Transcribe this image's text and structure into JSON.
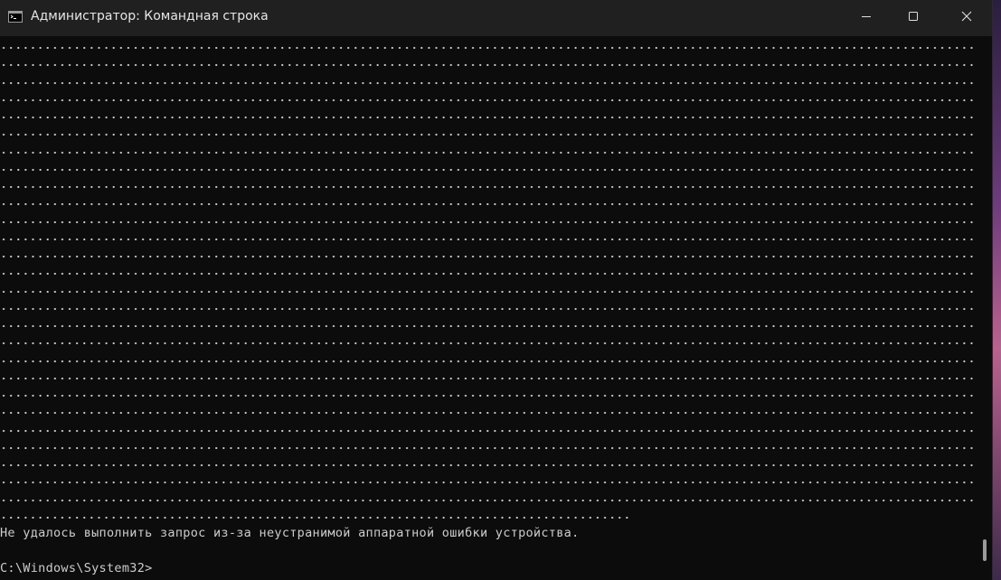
{
  "window": {
    "title": "Администратор: Командная строка",
    "icon": "cmd-icon",
    "controls": {
      "minimize_icon": "minimize-icon",
      "maximize_icon": "maximize-icon",
      "close_icon": "close-icon"
    }
  },
  "console": {
    "error_message": "Не удалось выполнить запрос из-за неустранимой аппаратной ошибки устройства.",
    "prompt": "C:\\Windows\\System32>"
  },
  "colors": {
    "background": "#0c0c0c",
    "titlebar": "#202020",
    "text": "#cccccc"
  }
}
